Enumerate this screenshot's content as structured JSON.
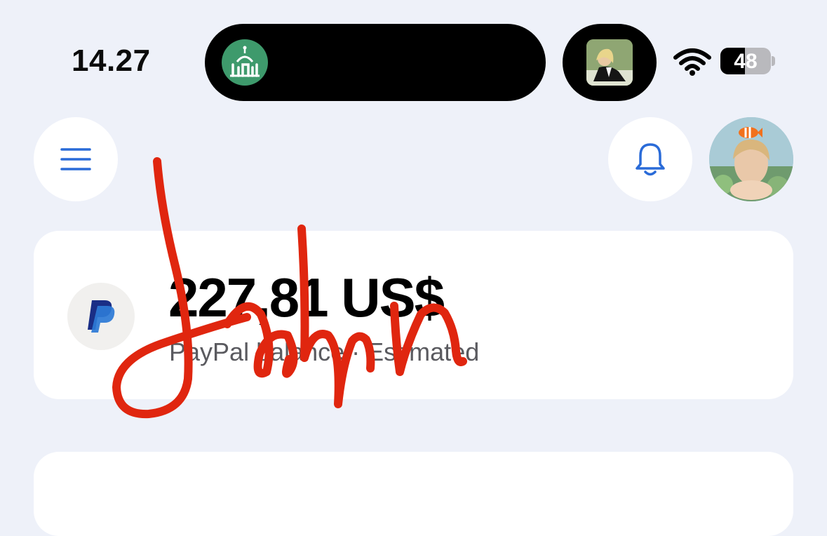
{
  "status_bar": {
    "time": "14.27",
    "battery_level": "48"
  },
  "header": {
    "menu_icon": "hamburger-menu-icon",
    "notifications_icon": "bell-icon"
  },
  "balance_card": {
    "amount": "227,81 US$",
    "label": "PayPal balance · Estimated",
    "logo": "paypal-logo"
  },
  "annotation": {
    "signature_text": "John",
    "color": "#e0260f"
  },
  "colors": {
    "background": "#eef1f9",
    "accent_blue": "#2a6bd8",
    "paypal_dark": "#1a2e86",
    "paypal_light": "#2c7ad6"
  }
}
